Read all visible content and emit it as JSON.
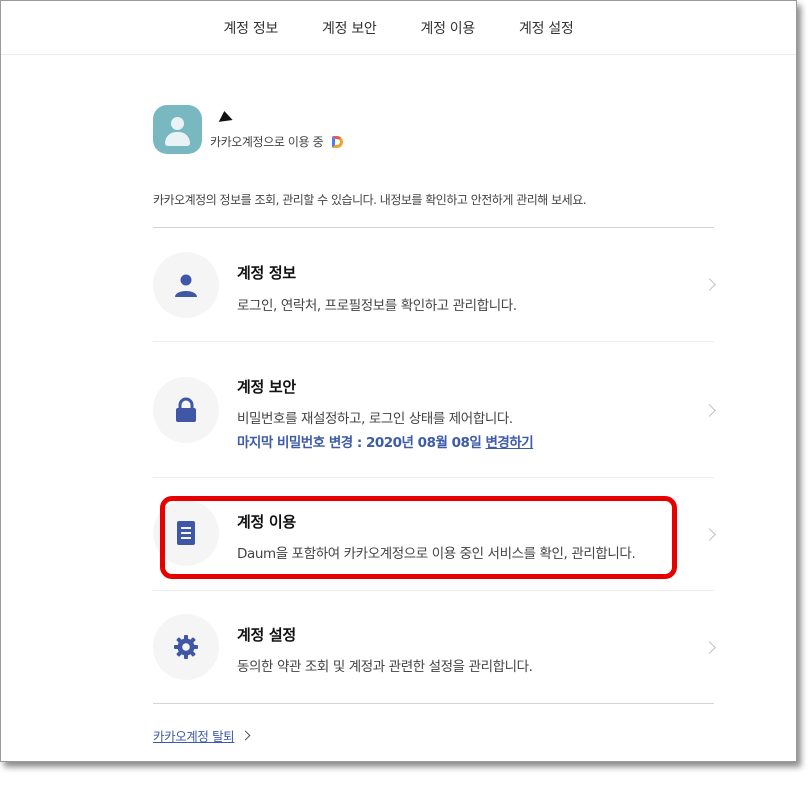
{
  "nav": {
    "tabs": [
      {
        "label": "계정 정보"
      },
      {
        "label": "계정 보안"
      },
      {
        "label": "계정 이용"
      },
      {
        "label": "계정 설정"
      }
    ]
  },
  "profile": {
    "status": "카카오계정으로 이용 중"
  },
  "intro": "카카오계정의 정보를 조회, 관리할 수 있습니다. 내정보를 확인하고 안전하게 관리해 보세요.",
  "cards": {
    "info": {
      "title": "계정 정보",
      "desc": "로그인, 연락처, 프로필정보를 확인하고 관리합니다."
    },
    "security": {
      "title": "계정 보안",
      "desc": "비밀번호를 재설정하고, 로그인 상태를 제어합니다.",
      "pw_changed": "마지막 비밀번호 변경 : 2020년 08월 08일",
      "change_link": "변경하기"
    },
    "usage": {
      "title": "계정 이용",
      "desc": "Daum을 포함하여 카카오계정으로 이용 중인 서비스를 확인, 관리합니다."
    },
    "settings": {
      "title": "계정 설정",
      "desc": "동의한 약관 조회 및 계정과 관련한 설정을 관리합니다."
    }
  },
  "withdraw_label": "카카오계정 탈퇴",
  "colors": {
    "accent_blue": "#3d5ba8",
    "icon_blue": "#3f57a6",
    "avatar_bg": "#79b8c1",
    "highlight_red": "#e80000"
  }
}
